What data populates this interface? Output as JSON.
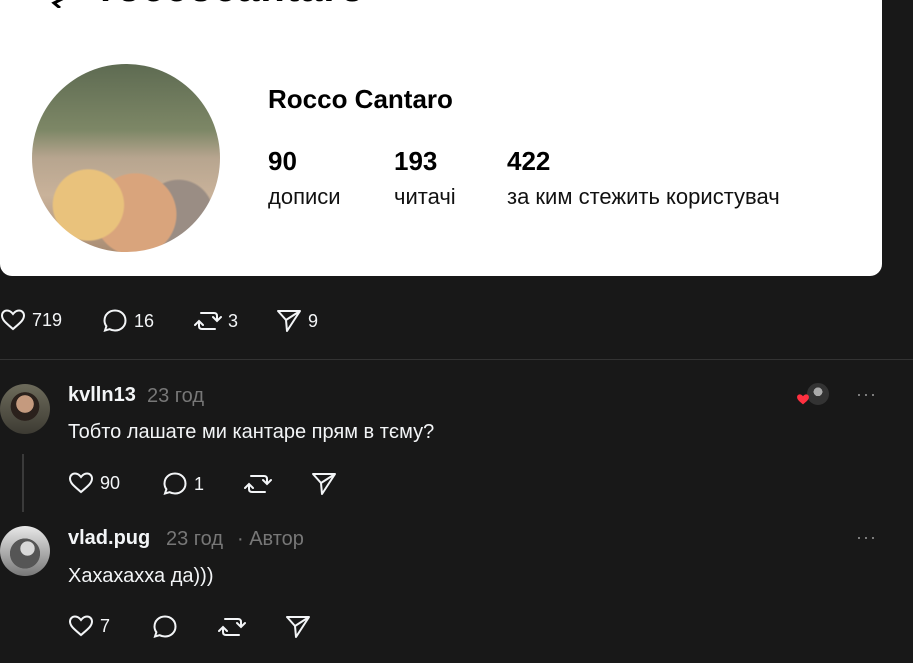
{
  "profile": {
    "header_title": "roccocantaro",
    "name": "Rocco Cantaro",
    "stats": [
      {
        "value": "90",
        "label": "дописи"
      },
      {
        "value": "193",
        "label": "читачі"
      },
      {
        "value": "422",
        "label": "за ким стежить користувач"
      }
    ]
  },
  "post_actions": {
    "likes": "719",
    "comments": "16",
    "reposts": "3",
    "shares": "9"
  },
  "comments": [
    {
      "username": "kvlln13",
      "time": "23 год",
      "text": "Тобто лашате ми кантаре прям в тєму?",
      "likes": "90",
      "replies": "1",
      "more": "···"
    },
    {
      "username": "vlad.pug",
      "time": "23 год",
      "author_badge": "· Автор",
      "text": "Хахахахха да)))",
      "likes": "7",
      "more": "···"
    }
  ],
  "colors": {
    "background": "#181818",
    "card": "#ffffff",
    "like_red": "#ff3040"
  }
}
